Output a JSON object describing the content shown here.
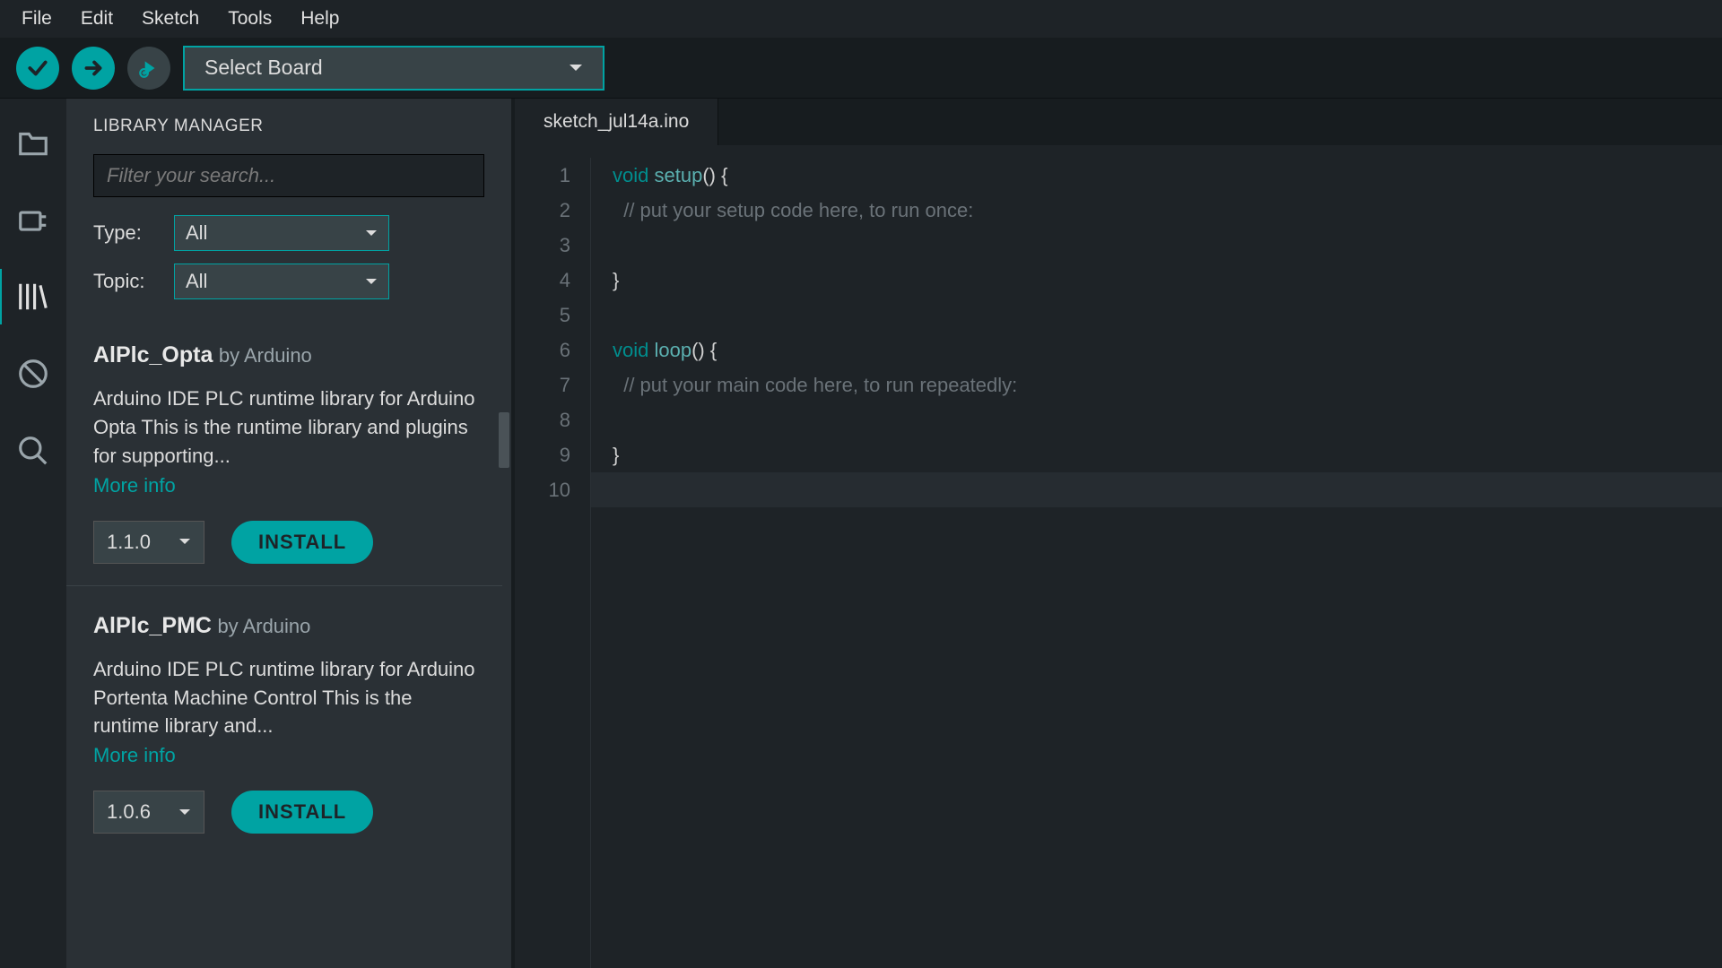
{
  "menu": [
    "File",
    "Edit",
    "Sketch",
    "Tools",
    "Help"
  ],
  "toolbar": {
    "board_label": "Select Board"
  },
  "panel": {
    "title": "LIBRARY MANAGER",
    "search_placeholder": "Filter your search...",
    "type_label": "Type:",
    "type_value": "All",
    "topic_label": "Topic:",
    "topic_value": "All"
  },
  "libs": [
    {
      "name": "AlPlc_Opta",
      "by": "by Arduino",
      "desc": "Arduino IDE PLC runtime library for Arduino Opta This is the runtime library and plugins for supporting...",
      "more": "More info",
      "version": "1.1.0",
      "install": "INSTALL"
    },
    {
      "name": "AlPlc_PMC",
      "by": "by Arduino",
      "desc": "Arduino IDE PLC runtime library for Arduino Portenta Machine Control This is the runtime library and...",
      "more": "More info",
      "version": "1.0.6",
      "install": "INSTALL"
    }
  ],
  "editor": {
    "tab": "sketch_jul14a.ino",
    "lines": [
      1,
      2,
      3,
      4,
      5,
      6,
      7,
      8,
      9,
      10
    ],
    "code": {
      "l1_kw": "void",
      "l1_fn": "setup",
      "l1_rest": "() {",
      "l2": "  // put your setup code here, to run once:",
      "l4": "}",
      "l6_kw": "void",
      "l6_fn": "loop",
      "l6_rest": "() {",
      "l7": "  // put your main code here, to run repeatedly:",
      "l9": "}"
    }
  }
}
